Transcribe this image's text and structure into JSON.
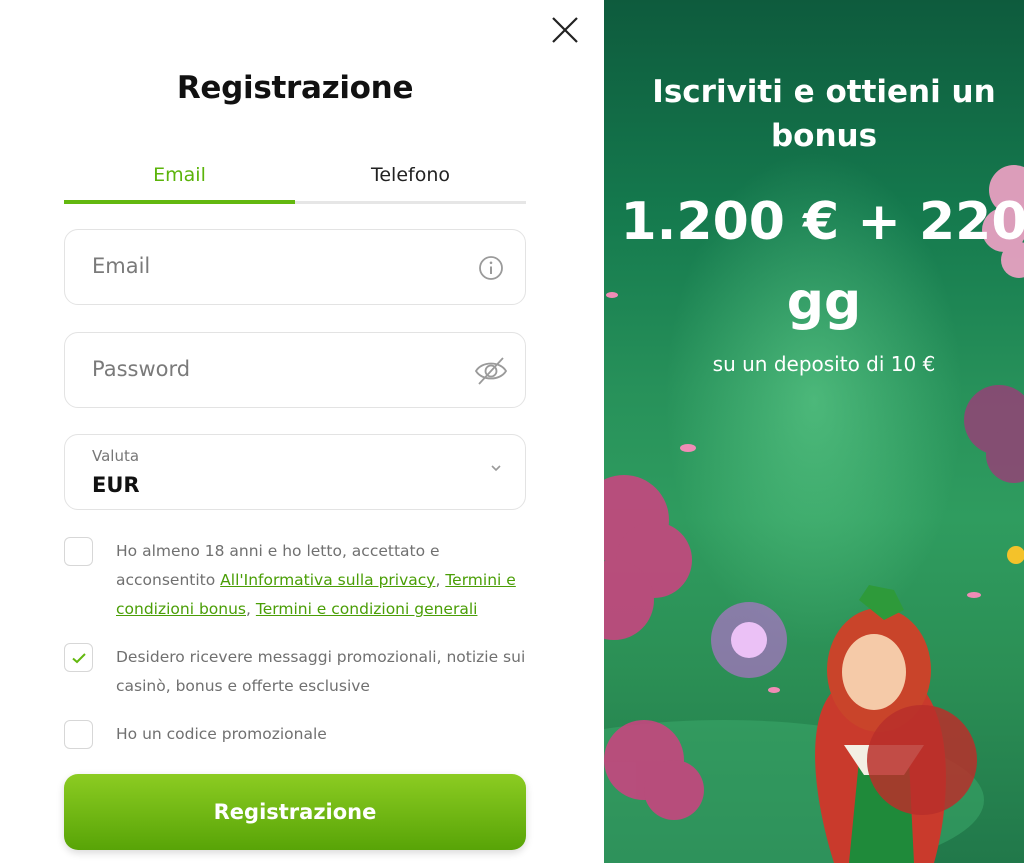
{
  "modal": {
    "title": "Registrazione",
    "tabs": [
      {
        "label": "Email",
        "active": true
      },
      {
        "label": "Telefono",
        "active": false
      }
    ],
    "email": {
      "placeholder": "Email",
      "icon": "info-icon"
    },
    "password": {
      "placeholder": "Password",
      "icon": "eye-off-icon"
    },
    "currency": {
      "label": "Valuta",
      "value": "EUR"
    },
    "checkboxes": {
      "age": {
        "checked": false,
        "text_before": "Ho almeno 18 anni e ho letto, accettato e acconsentito ",
        "link_privacy": "All'Informativa sulla privacy",
        "sep1": ", ",
        "link_bonus_terms": "Termini e condizioni bonus",
        "sep2": ", ",
        "link_general_terms": "Termini e condizioni generali"
      },
      "promo_messages": {
        "checked": true,
        "text": "Desidero ricevere messaggi promozionali, notizie sui casinò, bonus e offerte esclusive"
      },
      "promo_code": {
        "checked": false,
        "text": "Ho un codice promozionale"
      }
    },
    "submit_label": "Registrazione"
  },
  "promo": {
    "headline": "Iscriviti e ottieni un bonus",
    "amount": "1.200 € + 220 gg",
    "subtitle": "su un deposito di 10 €"
  },
  "colors": {
    "accent": "#63b80f",
    "link": "#4a9e06",
    "button_top": "#8ccc22",
    "button_bottom": "#58a407",
    "panel_green": "#157a4e"
  }
}
